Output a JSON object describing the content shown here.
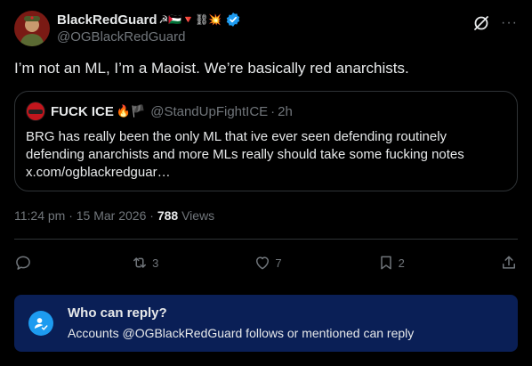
{
  "author": {
    "display_name": "BlackRedGuard",
    "emojis": "☭🇵🇸🔻⛓💥",
    "handle": "@OGBlackRedGuard",
    "verified": true
  },
  "tweet": {
    "text": "I’m not an ML, I’m a Maoist. We’re basically red anarchists.",
    "time": "11:24 pm · 15 Mar 2026",
    "views_count": "788",
    "views_label": "Views"
  },
  "quote": {
    "display_name": "FUCK ICE",
    "emojis": "🔥🏴",
    "handle": "@StandUpFightICE",
    "separator": "·",
    "time": "2h",
    "text": "BRG has really been the only ML that ive ever seen defending routinely defending anarchists and more MLs really should take some fucking notes",
    "link": "x.com/ogblackredguar…"
  },
  "actions": {
    "replies": "",
    "reposts": "3",
    "likes": "7",
    "bookmarks": "2"
  },
  "reply_notice": {
    "title": "Who can reply?",
    "subtitle": "Accounts @OGBlackRedGuard follows or mentioned can reply"
  },
  "colors": {
    "background": "#000000",
    "text": "#e7e9ea",
    "muted": "#71767b",
    "border": "#2f3336",
    "accent": "#1d9bf0",
    "notice_bg": "#0a1f56"
  },
  "icons": [
    "grok-icon",
    "more-icon",
    "verified-icon",
    "reply-icon",
    "repost-icon",
    "like-icon",
    "bookmark-icon",
    "share-icon",
    "person-icon"
  ]
}
